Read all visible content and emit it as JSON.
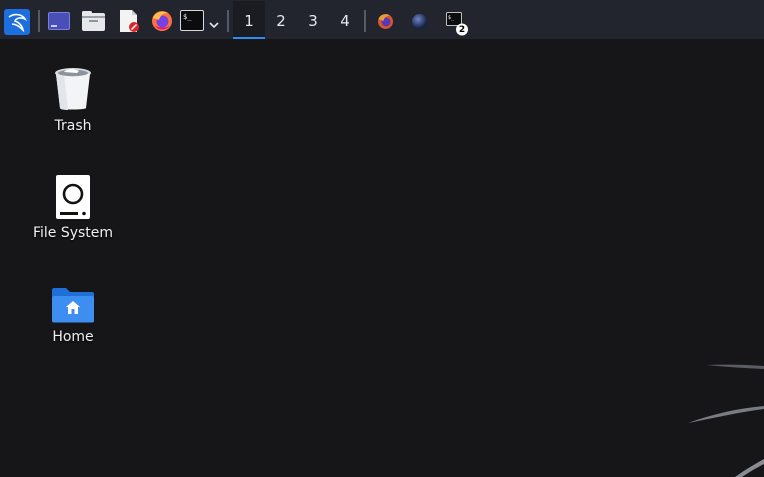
{
  "taskbar": {
    "launchers": [
      {
        "icon": "kali-menu-icon"
      },
      {
        "icon": "show-desktop-icon"
      },
      {
        "icon": "file-manager-icon"
      },
      {
        "icon": "text-editor-icon"
      },
      {
        "icon": "firefox-icon"
      },
      {
        "icon": "terminal-icon"
      },
      {
        "icon": "chevron-down-icon"
      }
    ],
    "workspaces": [
      {
        "label": "1",
        "active": true
      },
      {
        "label": "2",
        "active": false
      },
      {
        "label": "3",
        "active": false
      },
      {
        "label": "4",
        "active": false
      }
    ],
    "open_windows": [
      {
        "icon": "firefox-window-icon"
      },
      {
        "icon": "kali-undercover-window-icon"
      },
      {
        "icon": "terminal-window-icon",
        "badge": "2"
      }
    ],
    "accent_color": "#2f8bf0"
  },
  "desktop": {
    "background_color": "#161618",
    "icons": [
      {
        "label": "Trash",
        "icon": "trash-icon"
      },
      {
        "label": "File System",
        "icon": "drive-icon"
      },
      {
        "label": "Home",
        "icon": "home-folder-icon"
      }
    ]
  }
}
